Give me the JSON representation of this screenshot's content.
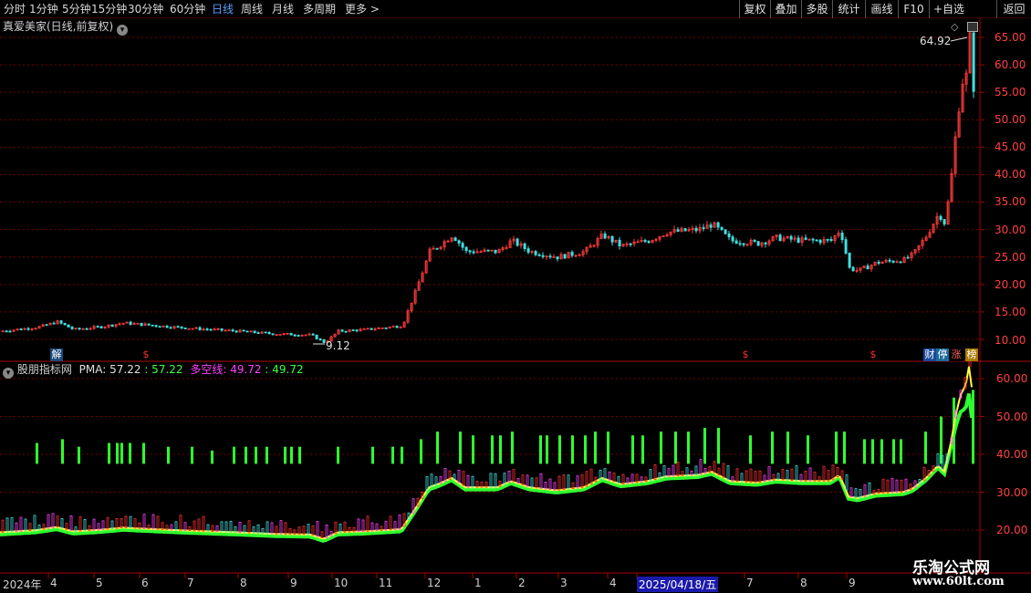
{
  "toolbar": {
    "periods": [
      "分时",
      "1分钟",
      "5分钟",
      "15分钟",
      "30分钟",
      "60分钟",
      "日线",
      "周线",
      "月线",
      "多周期",
      "更多 >"
    ],
    "active_period": "日线",
    "tools": [
      "复权",
      "叠加",
      "多股",
      "统计",
      "画线",
      "F10",
      "+自选",
      "返回"
    ]
  },
  "main_chart": {
    "title": "真爱美家(日线,前复权)",
    "high_label": "64.92",
    "low_label": "9.12",
    "y_ticks": [
      "65.00",
      "60.00",
      "55.00",
      "50.00",
      "45.00",
      "40.00",
      "35.00",
      "30.00",
      "25.00",
      "20.00",
      "15.00",
      "10.00"
    ]
  },
  "markers": {
    "jie": "解",
    "s1": "$",
    "s2": "$",
    "s3": "$",
    "cai": "财",
    "ting": "停",
    "zhang": "涨",
    "bang": "榜"
  },
  "sub_chart": {
    "title": "股朋指标网",
    "pma_label": "PMA: 57.22",
    "pma_value": ": 57.22",
    "dk_label": "多空线: 49.72",
    "dk_value": ": 49.72",
    "y_ticks": [
      "60.00",
      "50.00",
      "40.00",
      "30.00",
      "20.00"
    ]
  },
  "x_axis": {
    "labels": [
      "2024年",
      "4",
      "5",
      "6",
      "7",
      "8",
      "9",
      "10",
      "11",
      "12",
      "1",
      "2",
      "3",
      "4",
      "2025/04/18/五",
      "7",
      "8",
      "9"
    ]
  },
  "watermark": {
    "name": "乐淘公式网",
    "url": "www.60lt.com"
  },
  "colors": {
    "up": "#ff3b3b",
    "down": "#40e0e0",
    "pma": "#ffff40",
    "dk": "#40ff40",
    "grid": "#7a0000",
    "axis_text": "#ff4040"
  },
  "chart_data": {
    "type": "line",
    "title": "真爱美家(日线,前复权)",
    "ylim": [
      8,
      67
    ],
    "series": [
      {
        "values": [
          11.5,
          12,
          13,
          12.5,
          13.5,
          13,
          12.5,
          12,
          11.5,
          11,
          11.2,
          11.8,
          12,
          20,
          27,
          28,
          26,
          27,
          25,
          26,
          25,
          26,
          27,
          28,
          27,
          30,
          29,
          31,
          28,
          27,
          28,
          27,
          29,
          28,
          23,
          22,
          24,
          25,
          24,
          27,
          33,
          31,
          45,
          57,
          64.92
        ]
      }
    ],
    "sub_series": [
      {
        "name": "PMA",
        "values": [
          19,
          20,
          19.5,
          19,
          18.5,
          18,
          17.5,
          17,
          17.5,
          18,
          19,
          22,
          28,
          26,
          27,
          26,
          25,
          26,
          27,
          28,
          28,
          29,
          28,
          27.5,
          28,
          29,
          23,
          23,
          24,
          28,
          40,
          57.22
        ]
      },
      {
        "name": "多空线",
        "values": [
          19,
          19.5,
          19.5,
          19,
          18.5,
          18,
          17.5,
          17,
          17.5,
          18,
          18.5,
          21,
          26,
          26,
          26,
          26,
          25,
          26,
          27,
          28,
          28,
          29,
          28,
          27.5,
          28,
          28,
          24,
          23,
          24,
          26,
          35,
          49.72
        ]
      }
    ]
  }
}
